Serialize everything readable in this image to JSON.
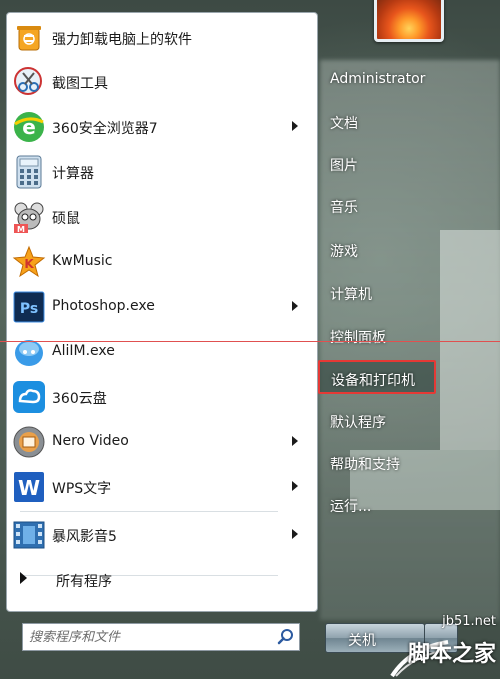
{
  "start_menu": {
    "programs": [
      {
        "label": "强力卸载电脑上的软件",
        "icon": "uninstall-icon",
        "has_submenu": false
      },
      {
        "label": "截图工具",
        "icon": "snipping-tool-icon",
        "has_submenu": false
      },
      {
        "label": "360安全浏览器7",
        "icon": "360-browser-icon",
        "has_submenu": true
      },
      {
        "label": "计算器",
        "icon": "calculator-icon",
        "has_submenu": false
      },
      {
        "label": "硕鼠",
        "icon": "shuoshu-icon",
        "has_submenu": false
      },
      {
        "label": "KwMusic",
        "icon": "kwmusic-icon",
        "has_submenu": false
      },
      {
        "label": "Photoshop.exe",
        "icon": "photoshop-icon",
        "has_submenu": true
      },
      {
        "label": "AliIM.exe",
        "icon": "aliim-icon",
        "has_submenu": false
      },
      {
        "label": "360云盘",
        "icon": "360-cloud-icon",
        "has_submenu": false
      },
      {
        "label": "Nero Video",
        "icon": "nero-video-icon",
        "has_submenu": true
      },
      {
        "label": "WPS文字",
        "icon": "wps-writer-icon",
        "has_submenu": true
      },
      {
        "label": "暴风影音5",
        "icon": "baofeng-icon",
        "has_submenu": true
      }
    ],
    "all_programs_label": "所有程序",
    "search_placeholder": "搜索程序和文件",
    "right_items": [
      {
        "label": "Administrator"
      },
      {
        "label": "文档"
      },
      {
        "label": "图片"
      },
      {
        "label": "音乐"
      },
      {
        "label": "游戏"
      },
      {
        "label": "计算机"
      },
      {
        "label": "控制面板"
      },
      {
        "label": "设备和打印机"
      },
      {
        "label": "默认程序"
      },
      {
        "label": "帮助和支持"
      },
      {
        "label": "运行..."
      }
    ],
    "shutdown_label": "关机",
    "highlight_color": "#e53935"
  },
  "watermark": {
    "site": "jb51.net",
    "name": "脚本之家"
  }
}
